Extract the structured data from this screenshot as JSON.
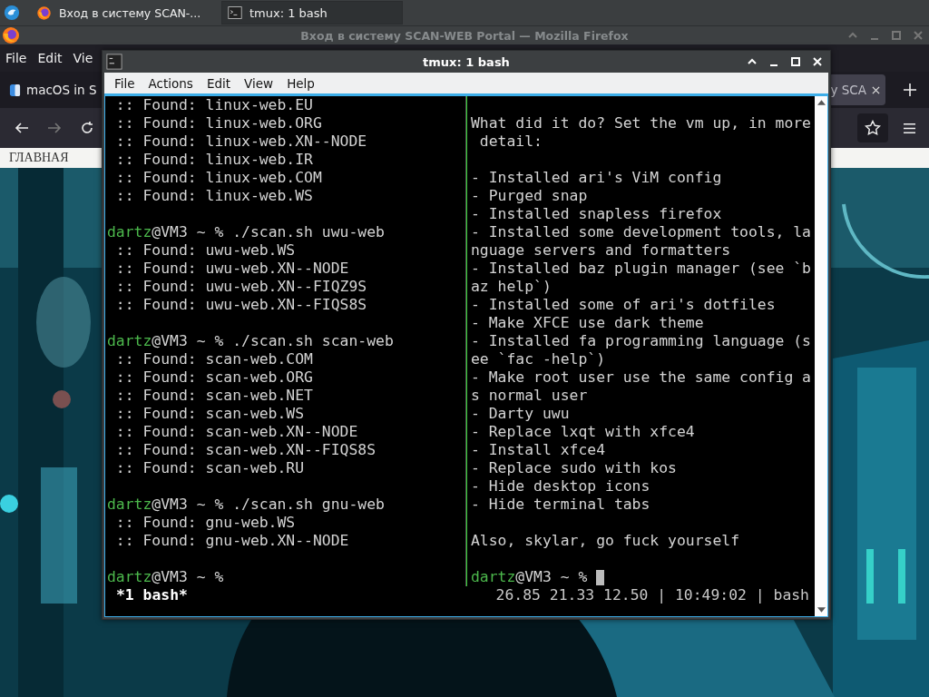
{
  "taskbar": {
    "buttons": [
      {
        "kind": "browser",
        "label": "Вход в систему SCAN-...",
        "selected": false
      },
      {
        "kind": "terminal",
        "label": "tmux: 1 bash",
        "selected": true
      }
    ]
  },
  "browser": {
    "title": "Вход в систему SCAN-WEB Portal — Mozilla Firefox",
    "menu": [
      "File",
      "Edit",
      "Vie"
    ],
    "tabs": [
      {
        "title": "macOS in S",
        "selected": false,
        "closable": false
      },
      {
        "title": "y SCA",
        "selected": true,
        "closable": true
      }
    ],
    "forward_disabled": true,
    "page": {
      "nav_link": "ГЛАВНАЯ",
      "kind": "picture"
    }
  },
  "terminal": {
    "title": "tmux: 1 bash",
    "menu": [
      "File",
      "Actions",
      "Edit",
      "View",
      "Help"
    ],
    "left_pane": {
      "lines": [
        {
          "kind": "output",
          "text": " :: Found: linux-web.EU"
        },
        {
          "kind": "output",
          "text": " :: Found: linux-web.ORG"
        },
        {
          "kind": "output",
          "text": " :: Found: linux-web.XN--NODE"
        },
        {
          "kind": "output",
          "text": " :: Found: linux-web.IR"
        },
        {
          "kind": "output",
          "text": " :: Found: linux-web.COM"
        },
        {
          "kind": "output",
          "text": " :: Found: linux-web.WS"
        },
        {
          "kind": "blank"
        },
        {
          "kind": "prompt",
          "user": "dartz",
          "text": "@VM3 ~ % ./scan.sh uwu-web"
        },
        {
          "kind": "output",
          "text": " :: Found: uwu-web.WS"
        },
        {
          "kind": "output",
          "text": " :: Found: uwu-web.XN--NODE"
        },
        {
          "kind": "output",
          "text": " :: Found: uwu-web.XN--FIQZ9S"
        },
        {
          "kind": "output",
          "text": " :: Found: uwu-web.XN--FIQS8S"
        },
        {
          "kind": "blank"
        },
        {
          "kind": "prompt",
          "user": "dartz",
          "text": "@VM3 ~ % ./scan.sh scan-web"
        },
        {
          "kind": "output",
          "text": " :: Found: scan-web.COM"
        },
        {
          "kind": "output",
          "text": " :: Found: scan-web.ORG"
        },
        {
          "kind": "output",
          "text": " :: Found: scan-web.NET"
        },
        {
          "kind": "output",
          "text": " :: Found: scan-web.WS"
        },
        {
          "kind": "output",
          "text": " :: Found: scan-web.XN--NODE"
        },
        {
          "kind": "output",
          "text": " :: Found: scan-web.XN--FIQS8S"
        },
        {
          "kind": "output",
          "text": " :: Found: scan-web.RU"
        },
        {
          "kind": "blank"
        },
        {
          "kind": "prompt",
          "user": "dartz",
          "text": "@VM3 ~ % ./scan.sh gnu-web"
        },
        {
          "kind": "output",
          "text": " :: Found: gnu-web.WS"
        },
        {
          "kind": "output",
          "text": " :: Found: gnu-web.XN--NODE"
        },
        {
          "kind": "blank"
        },
        {
          "kind": "prompt",
          "user": "dartz",
          "text": "@VM3 ~ %"
        }
      ]
    },
    "right_pane": {
      "lines": [
        {
          "kind": "blank"
        },
        {
          "kind": "output",
          "text": "What did it do? Set the vm up, in more"
        },
        {
          "kind": "output",
          "text": " detail:"
        },
        {
          "kind": "blank"
        },
        {
          "kind": "output",
          "text": "- Installed ari's ViM config"
        },
        {
          "kind": "output",
          "text": "- Purged snap"
        },
        {
          "kind": "output",
          "text": "- Installed snapless firefox"
        },
        {
          "kind": "output",
          "text": "- Installed some development tools, la"
        },
        {
          "kind": "output",
          "text": "nguage servers and formatters"
        },
        {
          "kind": "output",
          "text": "- Installed baz plugin manager (see `b"
        },
        {
          "kind": "output",
          "text": "az help`)"
        },
        {
          "kind": "output",
          "text": "- Installed some of ari's dotfiles"
        },
        {
          "kind": "output",
          "text": "- Make XFCE use dark theme"
        },
        {
          "kind": "output",
          "text": "- Installed fa programming language (s"
        },
        {
          "kind": "output",
          "text": "ee `fac -help`)"
        },
        {
          "kind": "output",
          "text": "- Make root user use the same config a"
        },
        {
          "kind": "output",
          "text": "s normal user"
        },
        {
          "kind": "output",
          "text": "- Darty uwu"
        },
        {
          "kind": "output",
          "text": "- Replace lxqt with xfce4"
        },
        {
          "kind": "output",
          "text": "- Install xfce4"
        },
        {
          "kind": "output",
          "text": "- Replace sudo with kos"
        },
        {
          "kind": "output",
          "text": "- Hide desktop icons"
        },
        {
          "kind": "output",
          "text": "- Hide terminal tabs"
        },
        {
          "kind": "blank"
        },
        {
          "kind": "output",
          "text": "Also, skylar, go fuck yourself"
        },
        {
          "kind": "blank"
        },
        {
          "kind": "prompt",
          "user": "dartz",
          "text": "@VM3 ~ %",
          "cursor": true
        }
      ]
    },
    "status_bar": {
      "window": "*1 bash*",
      "info": "26.85 21.33 12.50 | 10:49:02 | bash"
    }
  }
}
